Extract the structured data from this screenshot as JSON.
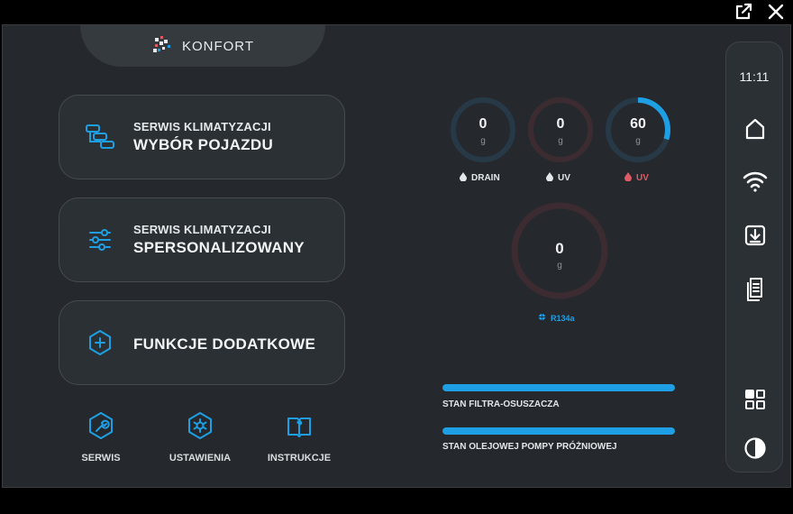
{
  "brand": {
    "name": "KONFORT"
  },
  "cards": [
    {
      "line1": "SERWIS KLIMATYZACJI",
      "line2": "WYBÓR POJAZDU",
      "icon": "vehicle-list-icon"
    },
    {
      "line1": "SERWIS KLIMATYZACJI",
      "line2": "SPERSONALIZOWANY",
      "icon": "sliders-icon"
    },
    {
      "line1": "",
      "line2": "FUNKCJE DODATKOWE",
      "icon": "add-hexagon-icon"
    }
  ],
  "bottom_nav": [
    {
      "label": "SERWIS",
      "icon": "wrench-icon"
    },
    {
      "label": "USTAWIENIA",
      "icon": "settings-icon"
    },
    {
      "label": "INSTRUKCJE",
      "icon": "manual-book-icon"
    }
  ],
  "gauges": {
    "drain": {
      "value": "0",
      "unit": "g",
      "label": "DRAIN",
      "fill_fraction": 0,
      "color": "#1f9fe3"
    },
    "uv1": {
      "value": "0",
      "unit": "g",
      "label": "UV",
      "fill_fraction": 0,
      "color": "#e05a66"
    },
    "uv2": {
      "value": "60",
      "unit": "g",
      "label": "UV",
      "fill_fraction": 0.3,
      "color": "#1f9fe3",
      "label_color": "#e05a66"
    },
    "r134a": {
      "value": "0",
      "unit": "g",
      "label": "R134a",
      "fill_fraction": 0,
      "color": "#e05a66",
      "label_color": "#1f9fe3"
    }
  },
  "status_bars": [
    {
      "label": "STAN FILTRA-OSUSZACZA",
      "fill_fraction": 1.0
    },
    {
      "label": "STAN OLEJOWEJ POMPY PRÓŻNIOWEJ",
      "fill_fraction": 1.0
    }
  ],
  "sidebar": {
    "time": "11:11",
    "items": [
      "home-icon",
      "wifi-icon",
      "download-icon",
      "documents-icon",
      "apps-grid-icon",
      "contrast-icon"
    ]
  },
  "window": {
    "icons": [
      "external-link-icon",
      "close-icon"
    ]
  },
  "colors": {
    "accent_blue": "#1f9fe3",
    "accent_red": "#e05a66",
    "background": "#25292d",
    "card": "#2b3034"
  }
}
